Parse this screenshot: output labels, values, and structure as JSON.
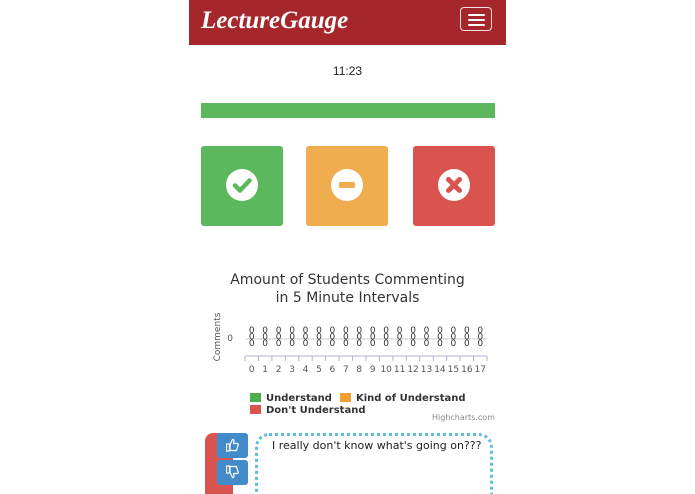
{
  "app": {
    "brand": "LectureGauge"
  },
  "status": {
    "time": "11:23",
    "progress_fraction": 1.0,
    "progress_color": "#5cb85c"
  },
  "vote_buttons": [
    {
      "name": "understand",
      "icon": "check-circle-icon",
      "color": "#5cb85c"
    },
    {
      "name": "kind-of-understand",
      "icon": "minus-circle-icon",
      "color": "#f0ad4e"
    },
    {
      "name": "dont-understand",
      "icon": "x-circle-icon",
      "color": "#d9534f"
    }
  ],
  "chart_data": {
    "type": "bar",
    "title_line1": "Amount of Students Commenting",
    "title_line2": "in 5 Minute Intervals",
    "ylabel": "Comments",
    "y_tick": "0",
    "categories": [
      "0",
      "1",
      "2",
      "3",
      "4",
      "5",
      "6",
      "7",
      "8",
      "9",
      "10",
      "11",
      "12",
      "13",
      "14",
      "15",
      "16",
      "17"
    ],
    "series": [
      {
        "name": "Understand",
        "color": "#4cae4c",
        "values": [
          0,
          0,
          0,
          0,
          0,
          0,
          0,
          0,
          0,
          0,
          0,
          0,
          0,
          0,
          0,
          0,
          0,
          0
        ]
      },
      {
        "name": "Kind of Understand",
        "color": "#f0a030",
        "values": [
          0,
          0,
          0,
          0,
          0,
          0,
          0,
          0,
          0,
          0,
          0,
          0,
          0,
          0,
          0,
          0,
          0,
          0
        ]
      },
      {
        "name": "Don't Understand",
        "color": "#d9534f",
        "values": [
          0,
          0,
          0,
          0,
          0,
          0,
          0,
          0,
          0,
          0,
          0,
          0,
          0,
          0,
          0,
          0,
          0,
          0
        ]
      }
    ],
    "legend_position": "bottom",
    "credit": "Highcharts.com"
  },
  "comment": {
    "text": "I really don't know what's going on???",
    "upvote_icon": "thumbs-up-icon",
    "downvote_icon": "thumbs-down-icon"
  }
}
